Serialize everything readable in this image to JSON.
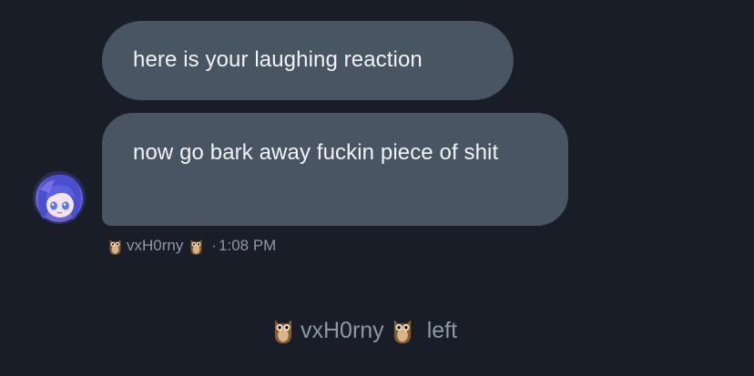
{
  "messages": [
    {
      "text": "here is your laughing reaction"
    },
    {
      "text": "now go bark away fuckin piece of shit"
    }
  ],
  "meta": {
    "username": "vxH0rny",
    "separator": "·",
    "time": "1:08 PM"
  },
  "system": {
    "username": "vxH0rny",
    "action": "left"
  },
  "icons": {
    "username_emoji": "owl-icon",
    "avatar": "anime-avatar"
  },
  "colors": {
    "background": "#181d27",
    "bubble": "#4a5564",
    "meta_text": "#8b98a5"
  }
}
